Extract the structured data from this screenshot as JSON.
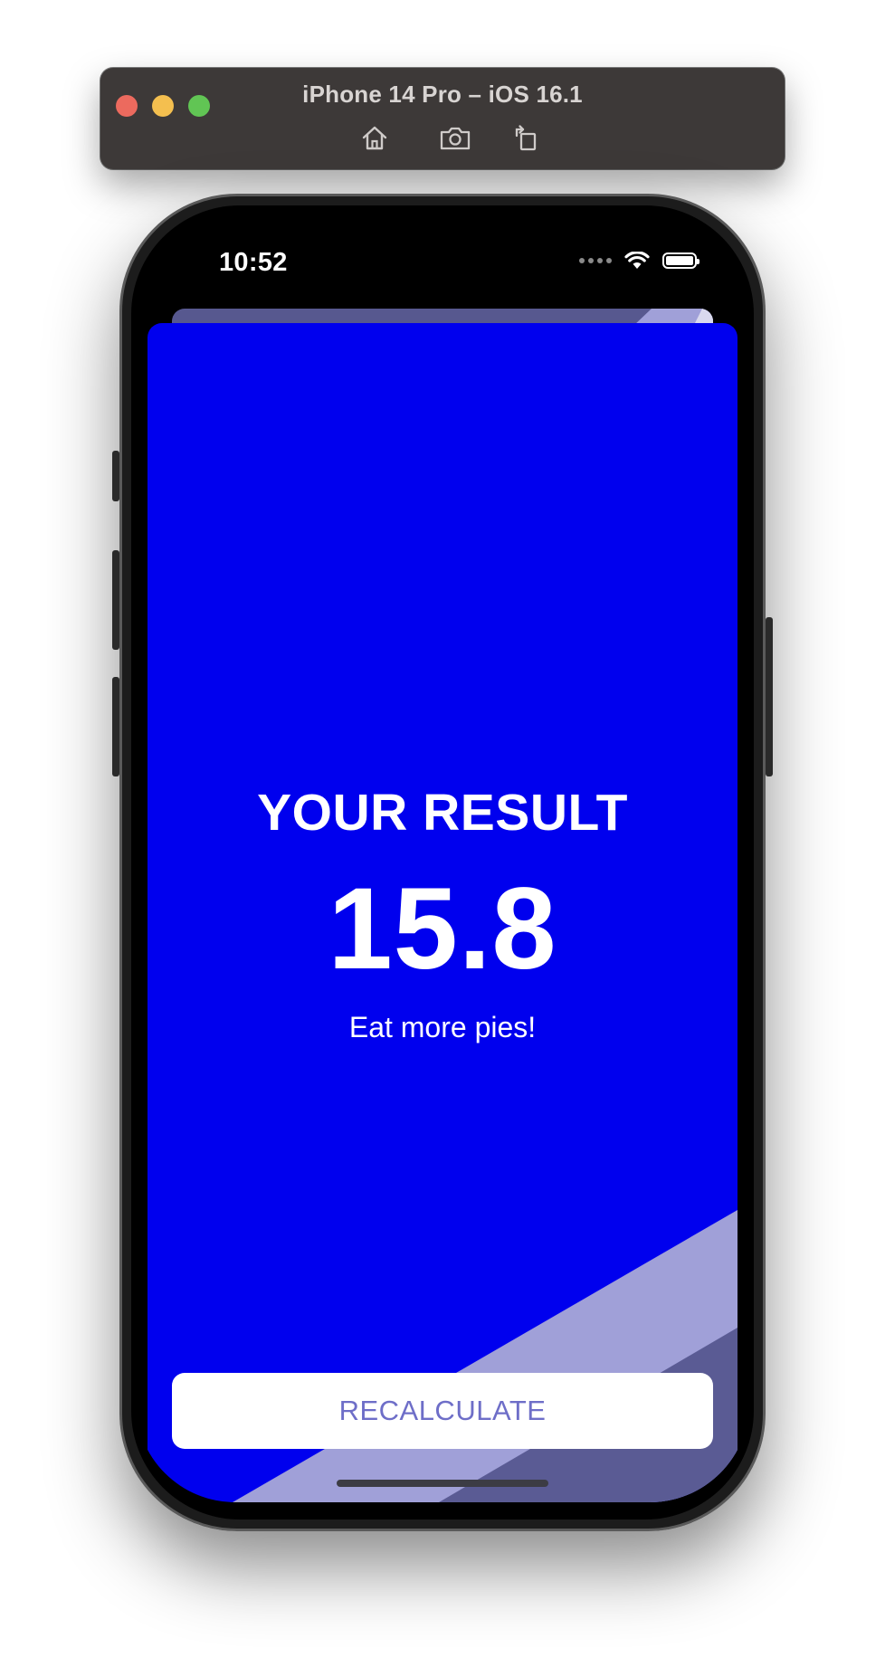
{
  "simulator": {
    "window_title": "iPhone 14 Pro – iOS 16.1",
    "toolbar_icons": [
      "home-icon",
      "screenshot-icon",
      "rotate-icon"
    ]
  },
  "status_bar": {
    "time": "10:52",
    "icons": [
      "cellular-signal-icon",
      "wifi-icon",
      "battery-icon"
    ]
  },
  "result_screen": {
    "title": "YOUR RESULT",
    "value": "15.8",
    "advice": "Eat more pies!",
    "recalculate_label": "RECALCULATE"
  },
  "colors": {
    "sheet_background": "#0000ee",
    "stripe_light": "#a0a0d8",
    "stripe_dark": "#5a5b94",
    "button_text": "#6e6ec8"
  }
}
